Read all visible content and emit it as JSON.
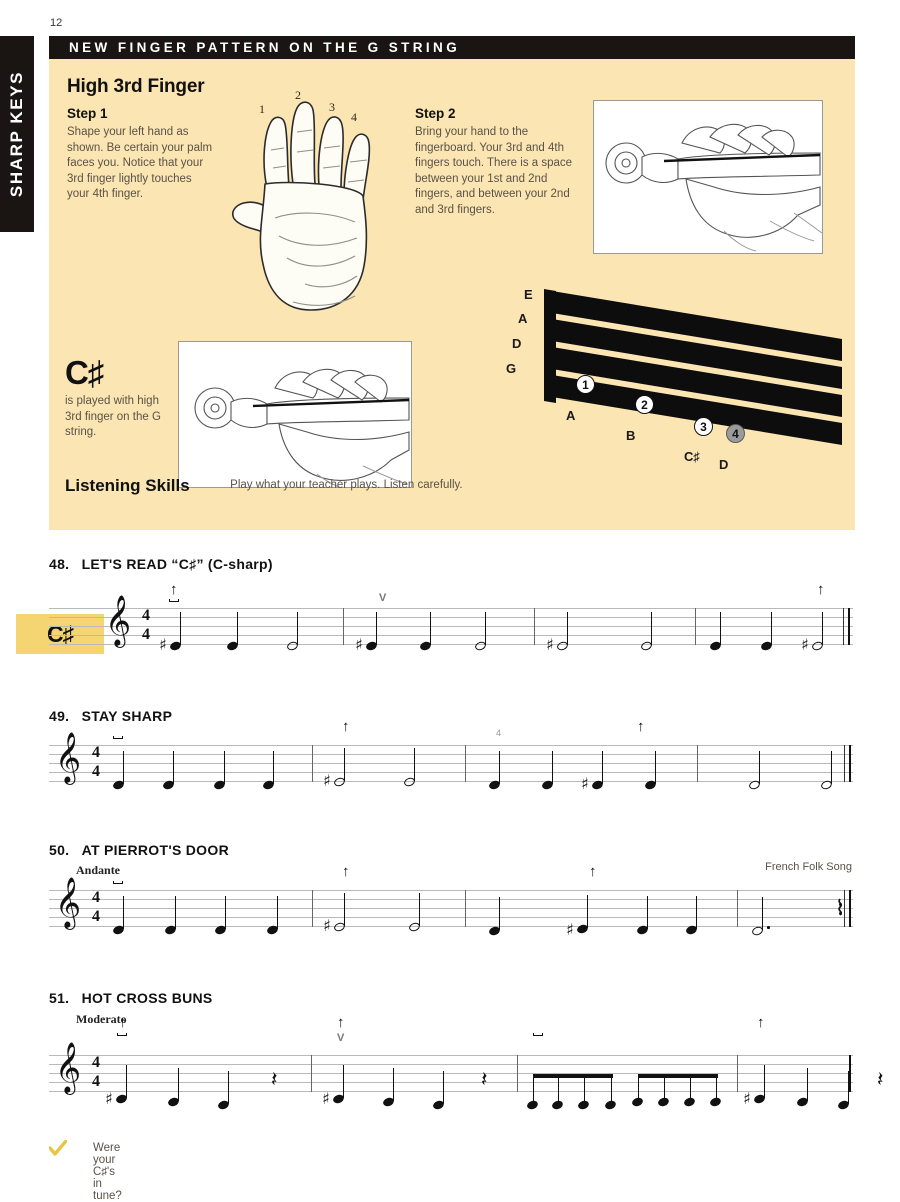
{
  "page": {
    "number": "12",
    "side_tab": "SHARP KEYS"
  },
  "panel": {
    "banner": "NEW FINGER PATTERN ON THE G STRING",
    "heading": "High 3rd Finger",
    "step1": {
      "label": "Step 1",
      "body": "Shape your left hand as shown.  Be certain your palm faces you.  Notice that your 3rd finger lightly touches your 4th finger."
    },
    "step2": {
      "label": "Step 2",
      "body": "Bring your hand to the fingerboard.  Your 3rd and 4th fingers touch.  There is a space between your 1st and 2nd fingers, and between your 2nd and 3rd fingers."
    },
    "hand_finger_numbers": [
      "1",
      "2",
      "3",
      "4"
    ],
    "csharp": {
      "symbol": "C♯",
      "body": "is played with high 3rd finger on the G string."
    },
    "fingerboard": {
      "open_strings": [
        "E",
        "A",
        "D",
        "G"
      ],
      "positions": [
        {
          "finger": "1",
          "note": "A",
          "highlight": false
        },
        {
          "finger": "2",
          "note": "B",
          "highlight": false
        },
        {
          "finger": "3",
          "note": "C♯",
          "highlight": false
        },
        {
          "finger": "4",
          "note": "D",
          "highlight": true
        }
      ]
    },
    "listening": {
      "title": "Listening Skills",
      "body": "Play what your teacher plays.  Listen carefully."
    }
  },
  "exercises": [
    {
      "number": "48.",
      "title": "LET'S READ “C♯” (C-sharp)",
      "key_badge": "C♯",
      "tempo": "",
      "composer": "",
      "time_signature": "4/4"
    },
    {
      "number": "49.",
      "title": "STAY SHARP",
      "key_badge": "",
      "tempo": "",
      "composer": "",
      "time_signature": "4/4"
    },
    {
      "number": "50.",
      "title": "AT PIERROT'S DOOR",
      "key_badge": "",
      "tempo": "Andante",
      "composer": "French Folk Song",
      "time_signature": "4/4"
    },
    {
      "number": "51.",
      "title": "HOT CROSS BUNS",
      "key_badge": "",
      "tempo": "Moderato",
      "composer": "",
      "time_signature": "4/4"
    }
  ],
  "markings": {
    "bow_down": "⊓",
    "bow_up": "V",
    "arrow_up": "↑",
    "quarter_rest": "⌇",
    "finger_4": "4"
  },
  "footer": {
    "question": "Were your C♯'s in tune?",
    "check_icon": "check-mark"
  },
  "colors": {
    "panel_bg": "#fbe5b2",
    "banner_bg": "#1a1512",
    "key_badge_bg": "#f4d572",
    "highlight_dot": "#9b9b9b",
    "body_text": "#5a5247"
  }
}
